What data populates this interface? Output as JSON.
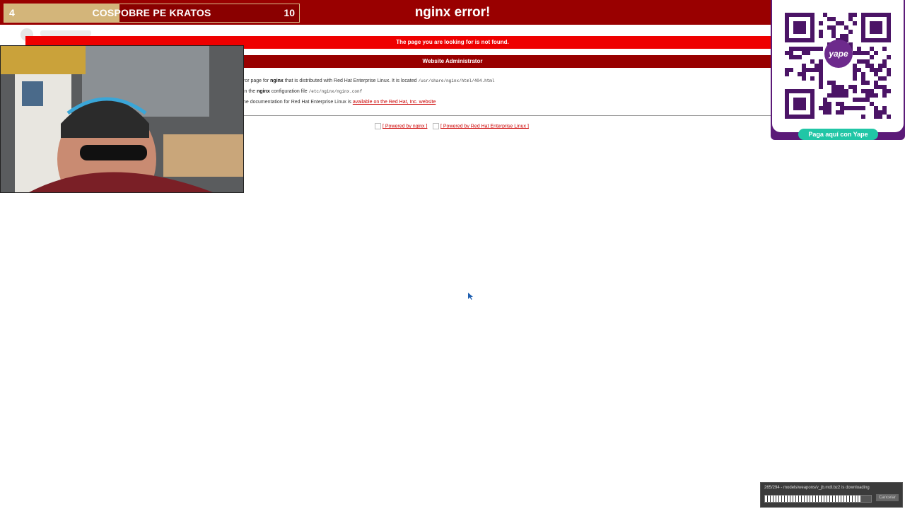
{
  "page": {
    "title": "nginx error!",
    "not_found": "The page you are looking for is not found.",
    "admin_heading": "Website Administrator",
    "line1_pre": "ror page for ",
    "line1_bold": "nginx",
    "line1_mid": " that is distributed with Red Hat Enterprise Linux.  It is located ",
    "line1_code": "/usr/share/nginx/html/404.html",
    "line2_pre": "in the ",
    "line2_bold": "nginx",
    "line2_mid": " configuration file ",
    "line2_code": "/etc/nginx/nginx.conf",
    "line3_pre": "ne documentation for Red Hat Enterprise Linux is ",
    "line3_link": "available on the Red Hat, Inc. website",
    "powered_nginx": "[ Powered by nginx ]",
    "powered_rhel": "[ Powered by Red Hat Enterprise Linux ]"
  },
  "scoreboard": {
    "left_score": "4",
    "title": "COSPOBRE PE KRATOS",
    "right_score": "10",
    "progress_fraction": 0.39,
    "colors": {
      "left": "#d3b57a",
      "right": "#8a0000"
    }
  },
  "qr": {
    "badge": "yape",
    "pay_label": "Paga aquí con Yape"
  },
  "download": {
    "message": "265/294 - models/weapons/v_jb.mdl.bz2 is downloading",
    "progress_fraction": 0.9,
    "cancel_label": "Cancelar"
  },
  "colors": {
    "nginx_dark": "#990000",
    "nginx_red": "#ee0000",
    "yape_purple": "#5b1a78",
    "yape_teal": "#21c6a6"
  }
}
